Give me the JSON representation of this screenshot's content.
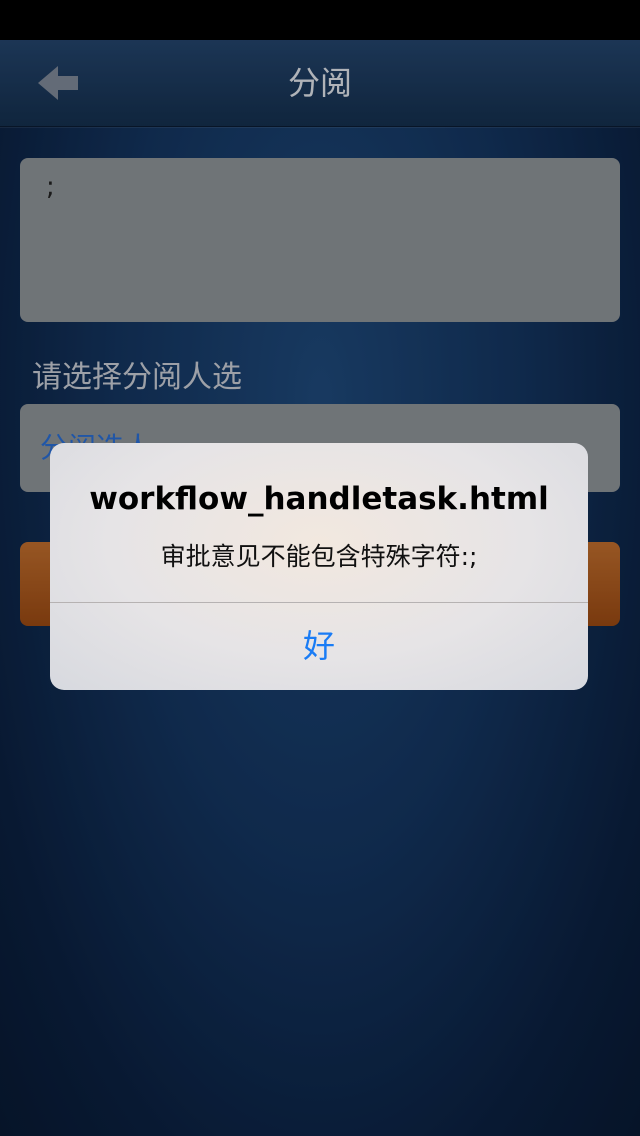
{
  "nav": {
    "title": "分阅",
    "back_icon": "back-arrow-icon"
  },
  "form": {
    "opinion_value": ";",
    "select_label": "请选择分阅人选",
    "reader_placeholder": "分阅选人"
  },
  "alert": {
    "title": "workflow_handletask.html",
    "message": "审批意见不能包含特殊字符:;",
    "ok_label": "好"
  },
  "colors": {
    "background": "#143560",
    "nav_bar": "#1c3a5e",
    "input_bg": "#8f9599",
    "submit_button": "#b35f22",
    "link_blue": "#1a7cf5"
  }
}
